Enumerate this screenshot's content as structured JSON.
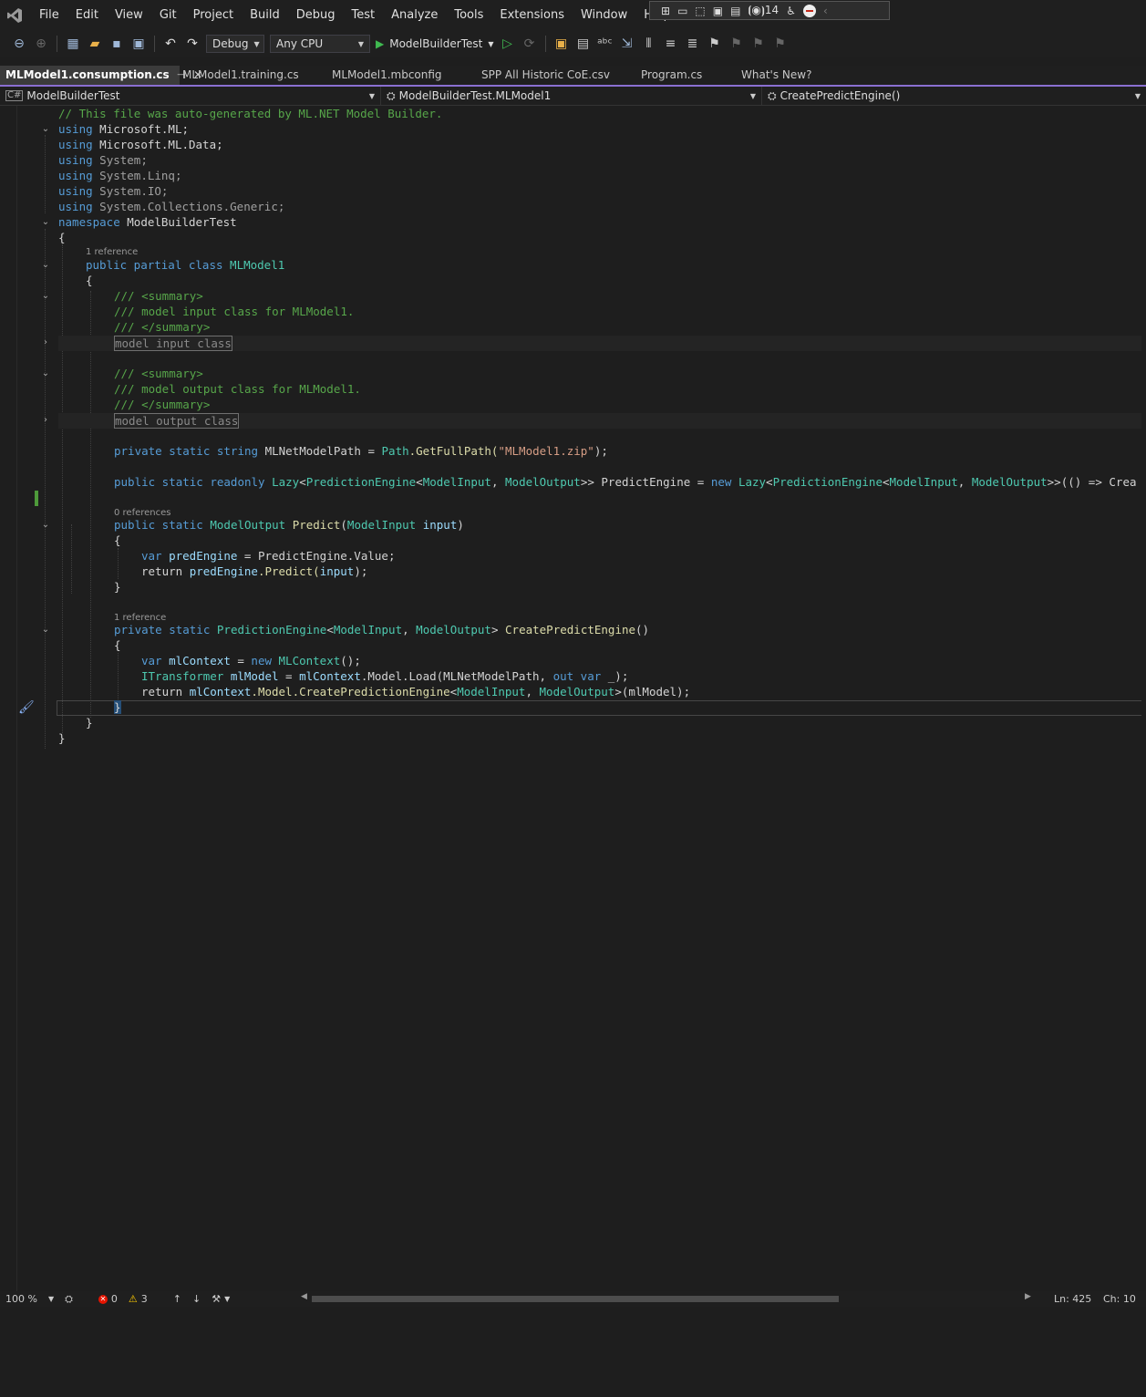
{
  "menu": {
    "items": [
      "File",
      "Edit",
      "View",
      "Git",
      "Project",
      "Build",
      "Debug",
      "Test",
      "Analyze",
      "Tools",
      "Extensions",
      "Window",
      "Help"
    ]
  },
  "floating_toolbar": {
    "count": "14"
  },
  "toolbar": {
    "configuration": "Debug",
    "platform": "Any CPU",
    "startup_project": "ModelBuilderTest"
  },
  "tabs": [
    {
      "label": "MLModel1.consumption.cs",
      "active": true
    },
    {
      "label": "MLModel1.training.cs"
    },
    {
      "label": "MLModel1.mbconfig"
    },
    {
      "label": "SPP All Historic CoE.csv"
    },
    {
      "label": "Program.cs"
    },
    {
      "label": "What's New?"
    }
  ],
  "navbar": {
    "project": "ModelBuilderTest",
    "type": "ModelBuilderTest.MLModel1",
    "member": "CreatePredictEngine()"
  },
  "codelens": {
    "class_refs": "1 reference",
    "predict_refs": "0 references",
    "create_refs": "1 reference"
  },
  "code": {
    "header_comment": "// This file was auto-generated by ML.NET Model Builder.",
    "using_kw": "using",
    "u1": "Microsoft.ML;",
    "u2": "Microsoft.ML.Data;",
    "u3": "System;",
    "u4": "System.Linq;",
    "u5": "System.IO;",
    "u6": "System.Collections.Generic;",
    "namespace_kw": "namespace",
    "namespace_name": "ModelBuilderTest",
    "open_brace": "{",
    "close_brace": "}",
    "class_mods": "public partial class",
    "class_name": "MLModel1",
    "summary_open": "/// <summary>",
    "summary_close": "/// </summary>",
    "input_doc": "/// model input class for MLModel1.",
    "input_collapsed": "model input class",
    "output_doc": "/// model output class for MLModel1.",
    "output_collapsed": "model output class",
    "path_mods": "private static string",
    "path_name": "MLNetModelPath",
    "path_eq": " = ",
    "path_type": "Path",
    "path_call": ".GetFullPath(",
    "path_str": "\"MLModel1.zip\"",
    "path_end": ");",
    "lazy_mods": "public static readonly",
    "lazy_t": "Lazy",
    "lazy_lt": "<",
    "lazy_pe": "PredictionEngine",
    "lazy_mi": "ModelInput",
    "lazy_comma": ", ",
    "lazy_mo": "ModelOutput",
    "lazy_gt": ">> ",
    "lazy_name": "PredictEngine",
    "lazy_eq": " = ",
    "lazy_new": "new",
    "lazy_tail": ">>(() => Crea",
    "predict_mods": "public static",
    "predict_ret": "ModelOutput",
    "predict_name": "Predict",
    "predict_param_t": "ModelInput",
    "predict_param": "input",
    "var_kw": "var",
    "pred_engine": "predEngine",
    "pred_assign": " = PredictEngine.Value;",
    "return_kw": "return",
    "pred_call": ".Predict(",
    "pred_end": ");",
    "create_mods": "private static",
    "create_ret_t": "PredictionEngine",
    "create_name": "CreatePredictEngine",
    "create_parens": "()",
    "ml_ctx": "mlContext",
    "new_kw": "new",
    "mlcontext_t": "MLContext",
    "call_end": "();",
    "itransformer": "ITransformer",
    "ml_model": "mlModel",
    "load_call": ".Model.Load(MLNetModelPath, ",
    "out_kw": "out",
    "load_end": " _);",
    "create_engine_call": ".Model.CreatePredictionEngine",
    "final_end": ">(mlModel);"
  },
  "status": {
    "zoom": "100 %",
    "errors": "0",
    "warnings": "3",
    "line": "Ln: 425",
    "col": "Ch: 10"
  }
}
